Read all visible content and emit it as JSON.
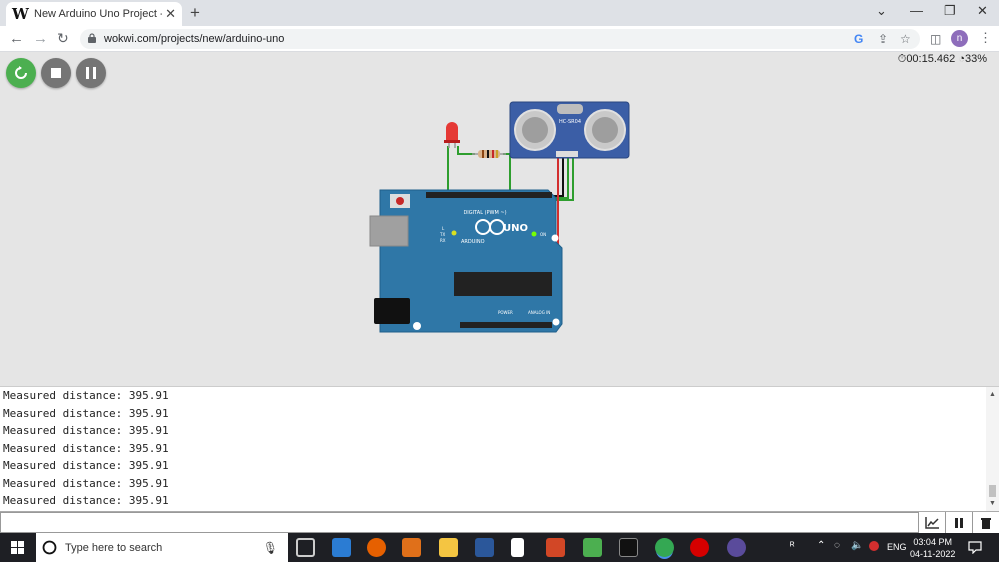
{
  "browser": {
    "tab_title": "New Arduino Uno Project - Wokwi",
    "tab_favicon": "W",
    "new_tab_label": "+",
    "url": "wokwi.com/projects/new/arduino-uno",
    "profile_initial": "n"
  },
  "sim": {
    "timer": "00:15.462",
    "speed": "33%",
    "led_color": "#e53935",
    "board": {
      "brand_label": "UNO",
      "maker_label": "ARDUINO",
      "digital_label": "DIGITAL (PWM ~)",
      "power_label": "POWER",
      "analog_label": "ANALOG IN",
      "on_label": "ON",
      "tx_label": "TX",
      "rx_label": "RX",
      "l_label": "L",
      "aref_label": "AREF",
      "gnd_label": "GND"
    },
    "sensor_label": "HC-SR04"
  },
  "serial": {
    "lines": [
      "Measured distance: 395.91",
      "Measured distance: 395.91",
      "Measured distance: 395.91",
      "Measured distance: 395.91",
      "Measured distance: 395.91",
      "Measured distance: 395.91",
      "Measured distance: 395.91"
    ],
    "input_value": ""
  },
  "taskbar": {
    "search_placeholder": "Type here to search",
    "lang": "ENG",
    "time": "03:04 PM",
    "date": "04-11-2022"
  }
}
